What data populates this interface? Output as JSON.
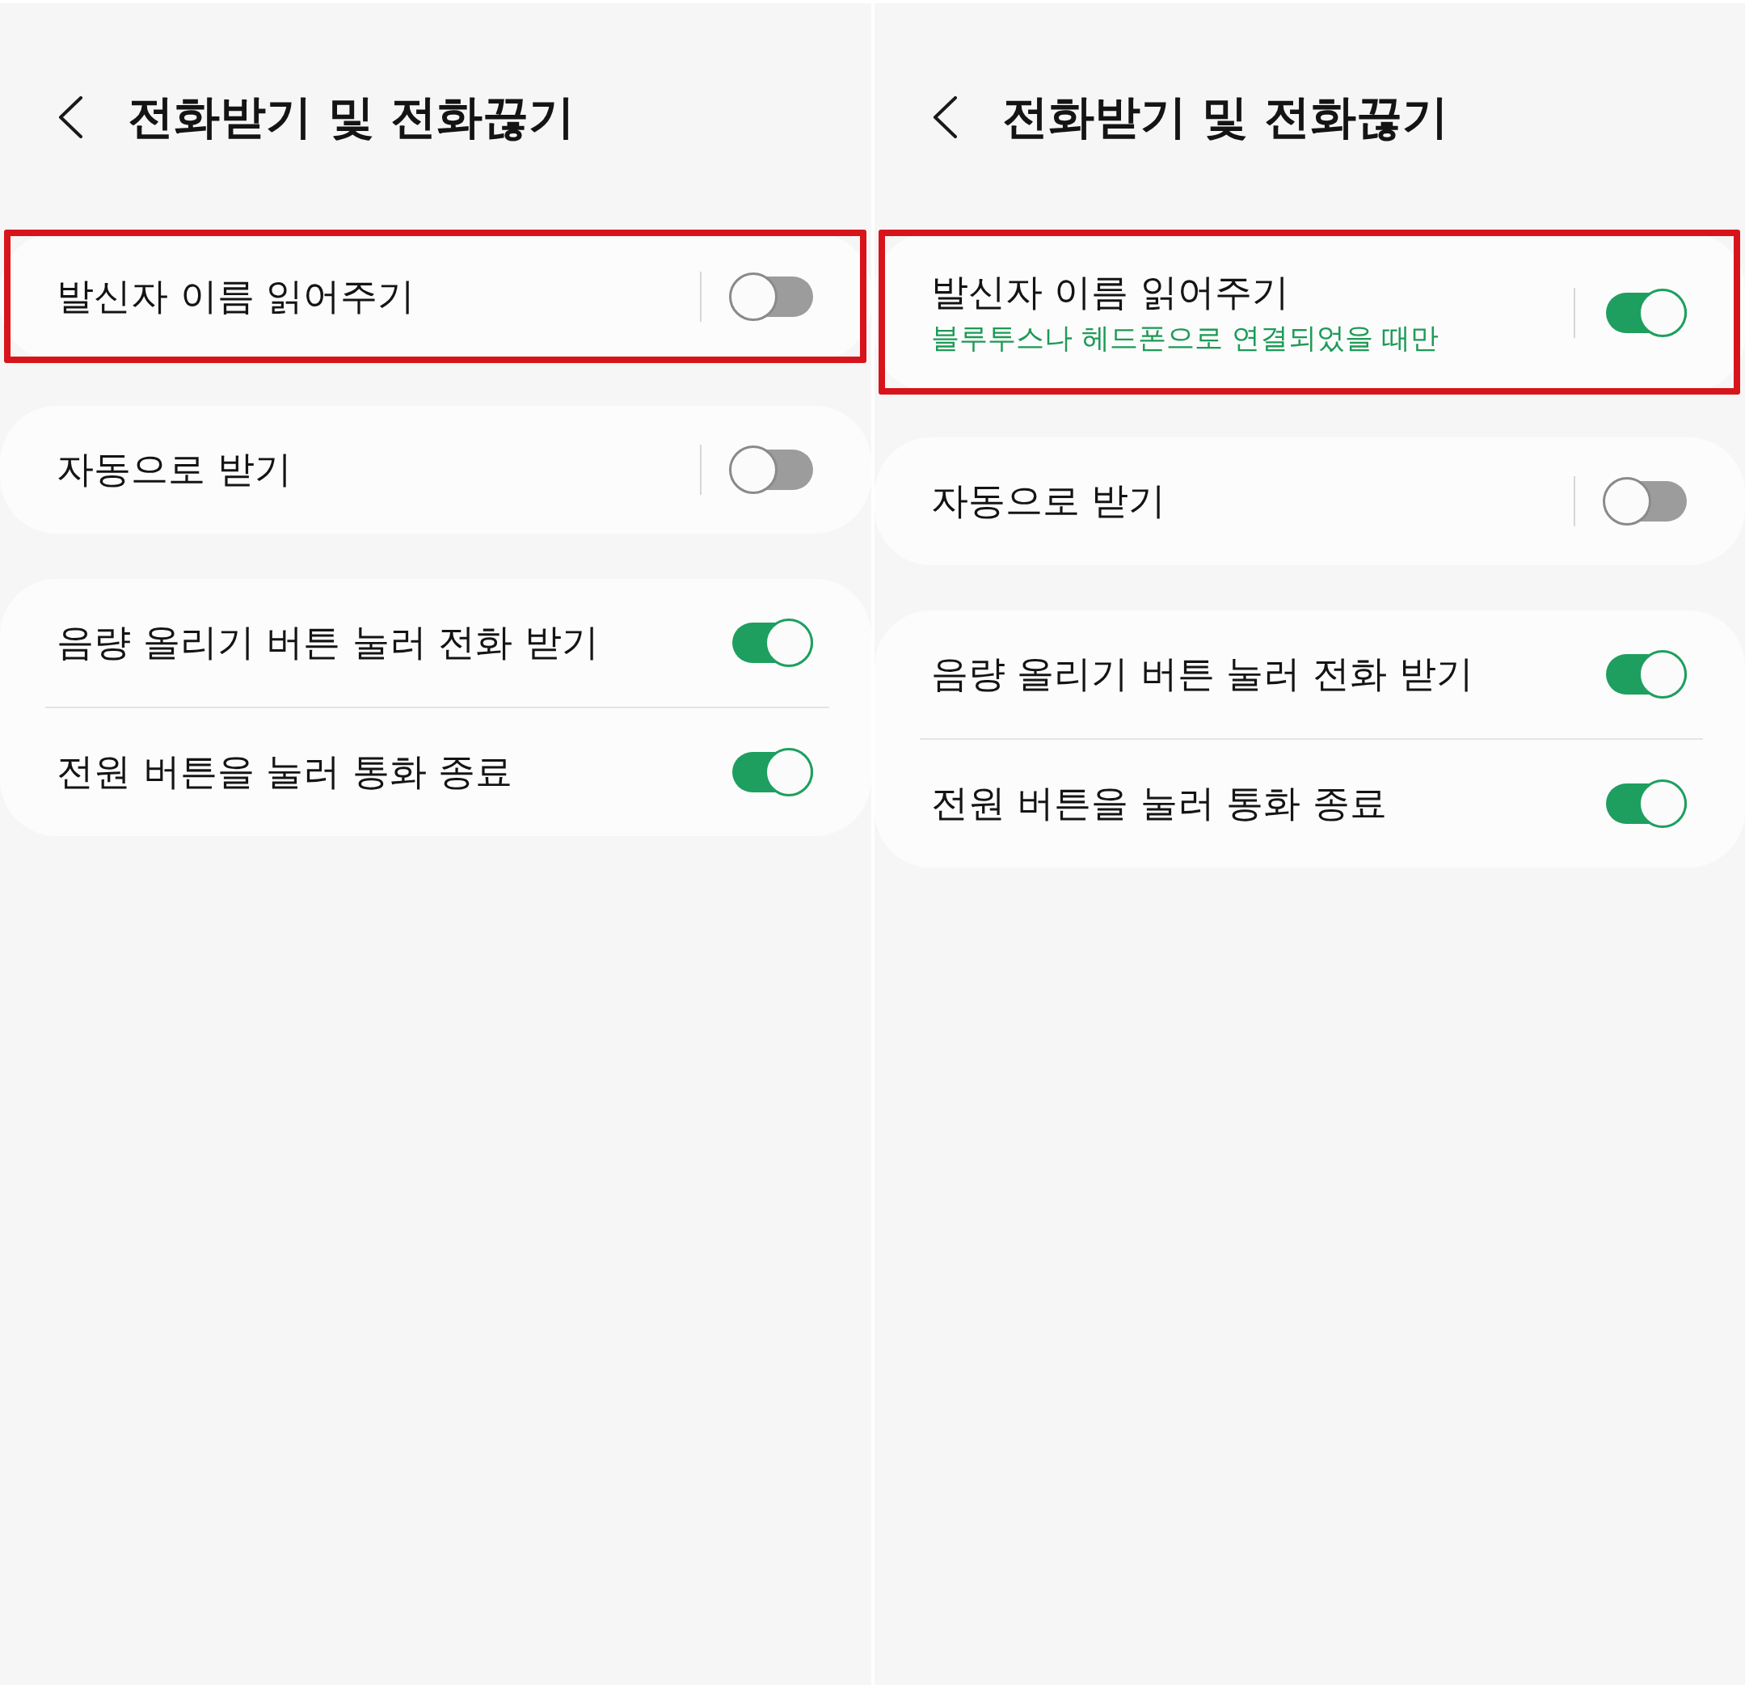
{
  "panels": [
    {
      "header": {
        "title": "전화받기 및 전화끊기"
      },
      "groups": [
        {
          "highlighted": true,
          "rows": [
            {
              "label": "발신자 이름 읽어주기",
              "split": true,
              "on": false
            }
          ]
        },
        {
          "highlighted": false,
          "rows": [
            {
              "label": "자동으로 받기",
              "split": true,
              "on": false
            }
          ]
        },
        {
          "highlighted": false,
          "rows": [
            {
              "label": "음량 올리기 버튼 눌러 전화 받기",
              "split": false,
              "on": true
            },
            {
              "label": "전원 버튼을 눌러 통화 종료",
              "split": false,
              "on": true
            }
          ]
        }
      ]
    },
    {
      "header": {
        "title": "전화받기 및 전화끊기"
      },
      "groups": [
        {
          "highlighted": true,
          "rows": [
            {
              "label": "발신자 이름 읽어주기",
              "summary": "블루투스나 헤드폰으로 연결되었을 때만",
              "split": true,
              "on": true
            }
          ]
        },
        {
          "highlighted": false,
          "rows": [
            {
              "label": "자동으로 받기",
              "split": true,
              "on": false
            }
          ]
        },
        {
          "highlighted": false,
          "rows": [
            {
              "label": "음량 올리기 버튼 눌러 전화 받기",
              "split": false,
              "on": true
            },
            {
              "label": "전원 버튼을 눌러 통화 종료",
              "split": false,
              "on": true
            }
          ]
        }
      ]
    }
  ]
}
